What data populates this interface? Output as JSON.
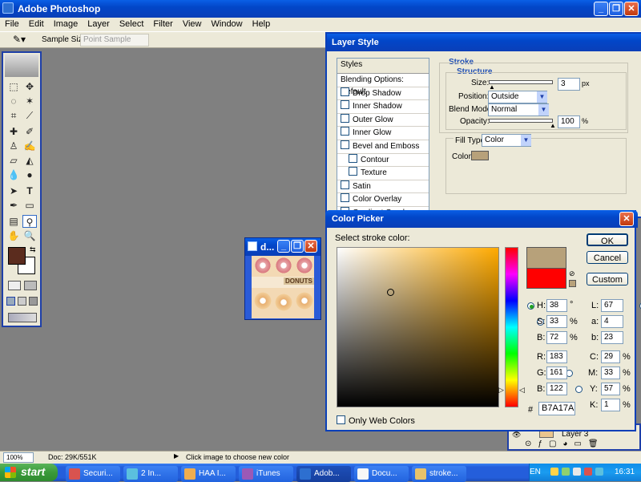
{
  "app": {
    "title": "Adobe Photoshop"
  },
  "menu": [
    "File",
    "Edit",
    "Image",
    "Layer",
    "Select",
    "Filter",
    "View",
    "Window",
    "Help"
  ],
  "options_bar": {
    "sample_size_label": "Sample Size:",
    "sample_size_value": "Point Sample"
  },
  "document": {
    "title": "d...",
    "banner_text": "DONUTS"
  },
  "layer_style": {
    "title": "Layer Style",
    "styles_header": "Styles",
    "items": [
      {
        "label": "Blending Options: Default",
        "checkbox": false,
        "indent": false
      },
      {
        "label": "Drop Shadow",
        "checkbox": true,
        "indent": false
      },
      {
        "label": "Inner Shadow",
        "checkbox": true,
        "indent": false
      },
      {
        "label": "Outer Glow",
        "checkbox": true,
        "indent": false
      },
      {
        "label": "Inner Glow",
        "checkbox": true,
        "indent": false
      },
      {
        "label": "Bevel and Emboss",
        "checkbox": true,
        "indent": false
      },
      {
        "label": "Contour",
        "checkbox": true,
        "indent": true
      },
      {
        "label": "Texture",
        "checkbox": true,
        "indent": true
      },
      {
        "label": "Satin",
        "checkbox": true,
        "indent": false
      },
      {
        "label": "Color Overlay",
        "checkbox": true,
        "indent": false
      },
      {
        "label": "Gradient Overlay",
        "checkbox": true,
        "indent": false
      }
    ],
    "stroke_header": "Stroke",
    "structure_header": "Structure",
    "size_label": "Size:",
    "size_value": "3",
    "size_unit": "px",
    "position_label": "Position:",
    "position_value": "Outside",
    "blend_mode_label": "Blend Mode:",
    "blend_mode_value": "Normal",
    "opacity_label": "Opacity:",
    "opacity_value": "100",
    "opacity_unit": "%",
    "fill_type_label": "Fill Type:",
    "fill_type_value": "Color",
    "color_label": "Color:",
    "stroke_color": "#B7A17A"
  },
  "color_picker": {
    "title": "Color Picker",
    "prompt": "Select stroke color:",
    "ok": "OK",
    "cancel": "Cancel",
    "custom": "Custom",
    "h": {
      "label": "H:",
      "value": "38",
      "unit": "°"
    },
    "s": {
      "label": "S:",
      "value": "33",
      "unit": "%"
    },
    "b": {
      "label": "B:",
      "value": "72",
      "unit": "%"
    },
    "r": {
      "label": "R:",
      "value": "183"
    },
    "g": {
      "label": "G:",
      "value": "161"
    },
    "bb": {
      "label": "B:",
      "value": "122"
    },
    "l": {
      "label": "L:",
      "value": "67"
    },
    "a": {
      "label": "a:",
      "value": "4"
    },
    "lab_b": {
      "label": "b:",
      "value": "23"
    },
    "c": {
      "label": "C:",
      "value": "29",
      "unit": "%"
    },
    "m": {
      "label": "M:",
      "value": "33",
      "unit": "%"
    },
    "y": {
      "label": "Y:",
      "value": "57",
      "unit": "%"
    },
    "k": {
      "label": "K:",
      "value": "1",
      "unit": "%"
    },
    "hash": "#",
    "hex": "B7A17A",
    "only_web_colors": "Only Web Colors",
    "new_color": "#B7A17A",
    "current_color": "#FF0000",
    "hue_base": "#FFAA00"
  },
  "layers_panel": {
    "layer_name": "Layer 3"
  },
  "status_bar": {
    "zoom": "100%",
    "doc": "Doc: 29K/551K",
    "hint": "Click image to choose new color"
  },
  "taskbar": {
    "start": "start",
    "buttons": [
      {
        "label": "Securi...",
        "icon": "shield-icon"
      },
      {
        "label": "2 In...",
        "icon": "ie-icon"
      },
      {
        "label": "HAA I...",
        "icon": "folder-icon"
      },
      {
        "label": "iTunes",
        "icon": "itunes-icon"
      },
      {
        "label": "Adob...",
        "icon": "photoshop-icon"
      },
      {
        "label": "Docu...",
        "icon": "document-icon"
      },
      {
        "label": "stroke...",
        "icon": "paint-icon"
      }
    ],
    "lang": "EN",
    "clock": "16:31"
  },
  "colors": {
    "foreground": "#5B2C1E",
    "background": "#FFFFFF"
  }
}
